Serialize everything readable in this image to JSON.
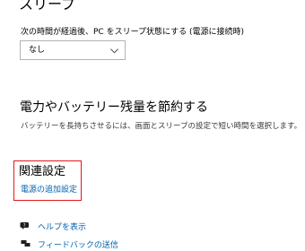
{
  "sleep": {
    "heading": "スリープ",
    "label": "次の時間が経過後、PC をスリープ状態にする (電源に接続時)",
    "selected": "なし"
  },
  "battery": {
    "heading": "電力やバッテリー残量を節約する",
    "description": "バッテリーを長持ちさせるには、画面とスリープの設定で短い時間を選択します。"
  },
  "related": {
    "heading": "関連設定",
    "link_additional_power": "電源の追加設定"
  },
  "help": {
    "show_help": "ヘルプを表示",
    "feedback": "フィードバックの送信"
  },
  "colors": {
    "link": "#0063b1",
    "highlight_border": "#e3171a"
  },
  "icons": [
    "chevron-down-icon",
    "help-chat-icon",
    "feedback-icon"
  ]
}
